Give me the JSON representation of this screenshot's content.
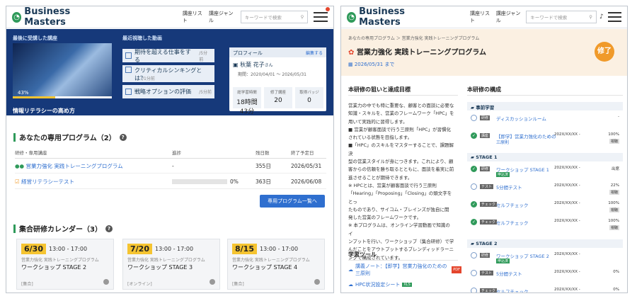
{
  "brand": {
    "name": "Business Masters",
    "accent": "#16397a",
    "green": "#2f9a5a"
  },
  "nav": {
    "list": "講座リスト",
    "genre": "講座ジャンル",
    "search_placeholder": "キーワードで検索"
  },
  "left": {
    "recent_course_label": "最後に受講した講座",
    "recent_course_title": "情報リテラシーの高め方",
    "recent_progress": "43%",
    "recent_progress_value": 0.43,
    "recent_videos_label": "最近視聴した動画",
    "videos": [
      {
        "title": "期待を超える仕事をする",
        "duration": "/5分前"
      },
      {
        "title": "クリティカルシンキングとは？",
        "duration": "/1分前"
      },
      {
        "title": "戦略オプションの評価",
        "duration": "/5分前"
      }
    ],
    "profile": {
      "label": "プロフィール",
      "edit": "編集する",
      "name": "秋葉 花子",
      "suffix": "さん",
      "period": "期間：2020/04/01 ～ 2026/05/31",
      "stats": [
        {
          "label": "総学習時間",
          "value": "18時間43分"
        },
        {
          "label": "修了講座",
          "value": "20"
        },
        {
          "label": "取得バッジ",
          "value": "0"
        }
      ]
    },
    "programs": {
      "title": "あなたの専用プログラム（2）",
      "cols": [
        "研修・専用講座",
        "進捗",
        "残日数",
        "終了予定日"
      ],
      "rows": [
        {
          "name": "営業力強化 実践トレーニングプログラム",
          "progress": "-",
          "days": "355日",
          "end": "2026/05/31"
        },
        {
          "name": "経営リテラシーテスト",
          "progress": "0%",
          "days": "363日",
          "end": "2026/06/08"
        }
      ],
      "button": "専用プログラム一覧へ"
    },
    "calendar": {
      "title": "集合研修カレンダー（3）",
      "cards": [
        {
          "date": "6/30",
          "time": "13:00 - 17:00",
          "program": "営業力強化 実践トレーニングプログラム",
          "session": "ワークショップ STAGE 2",
          "place": "[集合]"
        },
        {
          "date": "7/20",
          "time": "13:00 - 17:00",
          "program": "営業力強化 実践トレーニングプログラム",
          "session": "ワークショップ STAGE 3",
          "place": "[オンライン]"
        },
        {
          "date": "8/15",
          "time": "13:00 - 17:00",
          "program": "営業力強化 実践トレーニングプログラム",
          "session": "ワークショップ STAGE 4",
          "place": "[集合]"
        }
      ]
    }
  },
  "right": {
    "breadcrumb": "あなたの専用プログラム ＞ 営業力強化 実践トレーニングプログラム",
    "title": "営業力強化 実践トレーニングプログラム",
    "deadline": "2026/05/31 まで",
    "badge": "修了",
    "goal_title": "本研修の狙いと達成目標",
    "goal_lines": [
      "営業力の中でも特に重要な、顧客との面談に必要な",
      "知識・スキルを、営業のフレームワーク「HPC」を",
      "用いて実践的に習得します。",
      "■ 営業が顧客面談で行う三原則「HPC」が習慣化",
      "されている状態を目指します。",
      "■「HPC」のスキルをマスターすることで、課題解決",
      "型の営業スタイルが身につきます。これにより、顧",
      "客からの信頼を勝ち取るとともに、面談を着実に前",
      "進させることが期待できます。",
      "※ HPCとは、営業が顧客面談で行う三原則",
      "「Hearing」「Proposing」「Closing」の頭文字をとっ",
      "たものであり、サイコム・ブレインズが独自に開",
      "発した営業のフレームワークです。",
      "※ 本プログラムは、オンライン学習動画で知識のイ",
      "ンプットを行い、ワークショップ（集合研修）で学",
      "んだことをアウトプットするブレンディッドラーニ",
      "ングで構成されています。"
    ],
    "tools_title": "学習ツール",
    "tools": [
      "講義ノート：【即学】営業力強化のための三原則",
      "HPC状況設定シート"
    ],
    "structure_title": "本研修の構成",
    "groups": [
      {
        "name": "事前学習",
        "items": [
          {
            "done": false,
            "tag": "研修",
            "title": "ディスカッションルーム",
            "date": "",
            "pct": "-",
            "status": ""
          },
          {
            "done": true,
            "tag": "講座",
            "title": "【即学】営業力強化のための",
            "sub": "三原則",
            "date": "202X/XX/XX -",
            "pct": "100%",
            "status": "視聴"
          }
        ]
      },
      {
        "name": "STAGE 1",
        "items": [
          {
            "done": true,
            "tag": "研修",
            "title": "ワークショップ STAGE 1",
            "label": "申込済",
            "date": "202X/XX/XX -",
            "pct": "出席",
            "status": ""
          },
          {
            "done": false,
            "tag": "テスト",
            "title": "5分間テスト",
            "date": "202X/XX/XX -",
            "pct": "22%",
            "status": "視聴"
          },
          {
            "done": true,
            "tag": "チェック",
            "title": "セルフチェック",
            "date": "202X/XX/XX -",
            "pct": "100%",
            "status": "視聴"
          },
          {
            "done": true,
            "tag": "チェック",
            "title": "セルフチェック",
            "date": "202X/XX/XX -",
            "pct": "100%",
            "status": "視聴"
          }
        ]
      },
      {
        "name": "STAGE 2",
        "items": [
          {
            "done": false,
            "tag": "研修",
            "title": "ワークショップ STAGE 2",
            "label": "申込済",
            "date": "202X/XX/XX -",
            "pct": "",
            "status": ""
          },
          {
            "done": false,
            "tag": "テスト",
            "title": "5分間テスト",
            "date": "202X/XX/XX -",
            "pct": "0%",
            "status": ""
          },
          {
            "done": false,
            "tag": "チェック",
            "title": "セルフチェック",
            "date": "202X/XX/XX -",
            "pct": "0%",
            "status": ""
          }
        ]
      }
    ]
  }
}
